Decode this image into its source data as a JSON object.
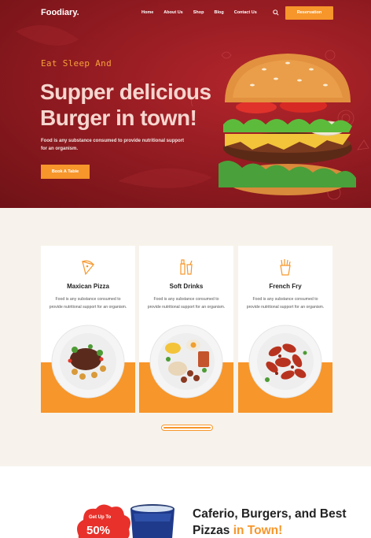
{
  "nav": {
    "logo": "Foodiary.",
    "links": [
      "Home",
      "About Us",
      "Shop",
      "Blog",
      "Contact Us"
    ],
    "reserve_label": "Reservation"
  },
  "hero": {
    "eyebrow": "Eat Sleep And",
    "headline": "Supper delicious Burger in town!",
    "subtext": "Food is any substance consumed to provide nutritional support for an organism.",
    "cta_label": "Book A Table"
  },
  "cards": [
    {
      "title": "Maxican Pizza",
      "desc": "Food is any substance consumed to provide nutritional support for an organism.",
      "icon": "pizza-slice-icon"
    },
    {
      "title": "Soft Drinks",
      "desc": "Food is any substance consumed to provide nutritional support for an organism.",
      "icon": "drinks-icon"
    },
    {
      "title": "French Fry",
      "desc": "Food is any substance consumed to provide nutritional support for an organism.",
      "icon": "french-fries-icon"
    }
  ],
  "promo": {
    "badge_top": "Get Up To",
    "badge_pct": "50%",
    "tagline_main": "Caferio, Burgers, and Best Pizzas ",
    "tagline_accent": "in Town!"
  },
  "colors": {
    "accent": "#f7962a",
    "hero_red": "#9b1f25",
    "section_bg": "#f7f3ec"
  }
}
